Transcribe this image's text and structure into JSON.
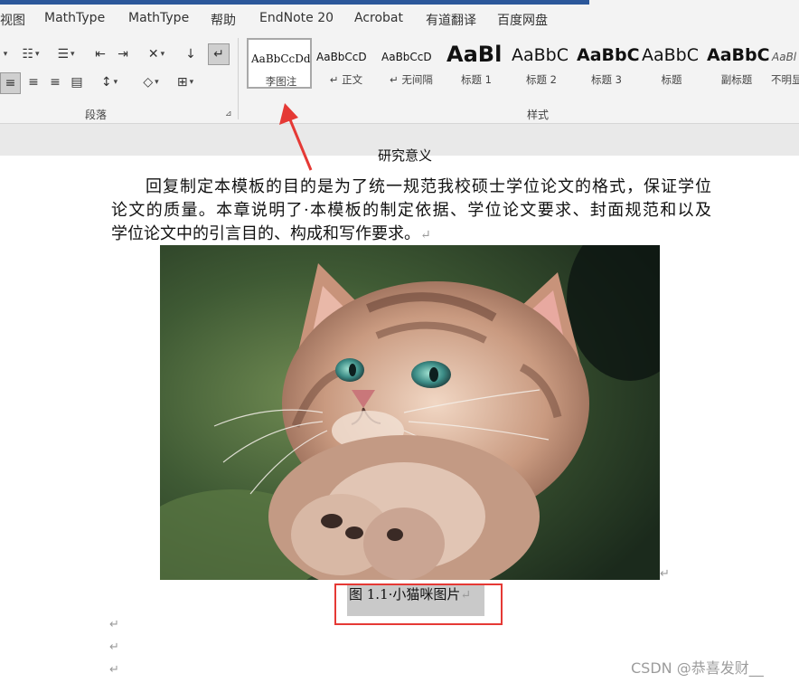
{
  "tabs": [
    "视图",
    "MathType",
    "MathType",
    "帮助",
    "EndNote 20",
    "Acrobat",
    "有道翻译",
    "百度网盘"
  ],
  "ribbon": {
    "paragraph_group_label": "段落",
    "styles_group_label": "样式",
    "styles": [
      {
        "sample": "AaBbCcDdI",
        "name": "李图注"
      },
      {
        "sample": "AaBbCcD",
        "name": "↵ 正文"
      },
      {
        "sample": "AaBbCcD",
        "name": "↵ 无间隔"
      },
      {
        "sample": "AaBl",
        "name": "标题 1"
      },
      {
        "sample": "AaBbC",
        "name": "标题 2"
      },
      {
        "sample": "AaBbC",
        "name": "标题 3"
      },
      {
        "sample": "AaBbC",
        "name": "标题"
      },
      {
        "sample": "AaBbC",
        "name": "副标题"
      },
      {
        "sample": "AaBl",
        "name": "不明显"
      }
    ]
  },
  "document": {
    "cut_heading": "研究意义",
    "paragraph_lines": [
      "回复制定本模板的目的是为了统一规范我校硕士学位论文的格式，保证学位",
      "论文的质量。本章说明了·本模板的制定依据、学位论文要求、封面规范和以及",
      "学位论文中的引言目的、构成和写作要求。"
    ],
    "paragraph_mark": "↵",
    "image_alt": "小猫咪图片",
    "caption": "图 1.1·小猫咪图片",
    "caption_mark": "↵",
    "empty_marks": [
      "↵",
      "↵",
      "↵"
    ]
  },
  "annotation": {
    "box_color": "#e53935",
    "arrow_color": "#e53935"
  },
  "watermark": "CSDN @恭喜发财__"
}
